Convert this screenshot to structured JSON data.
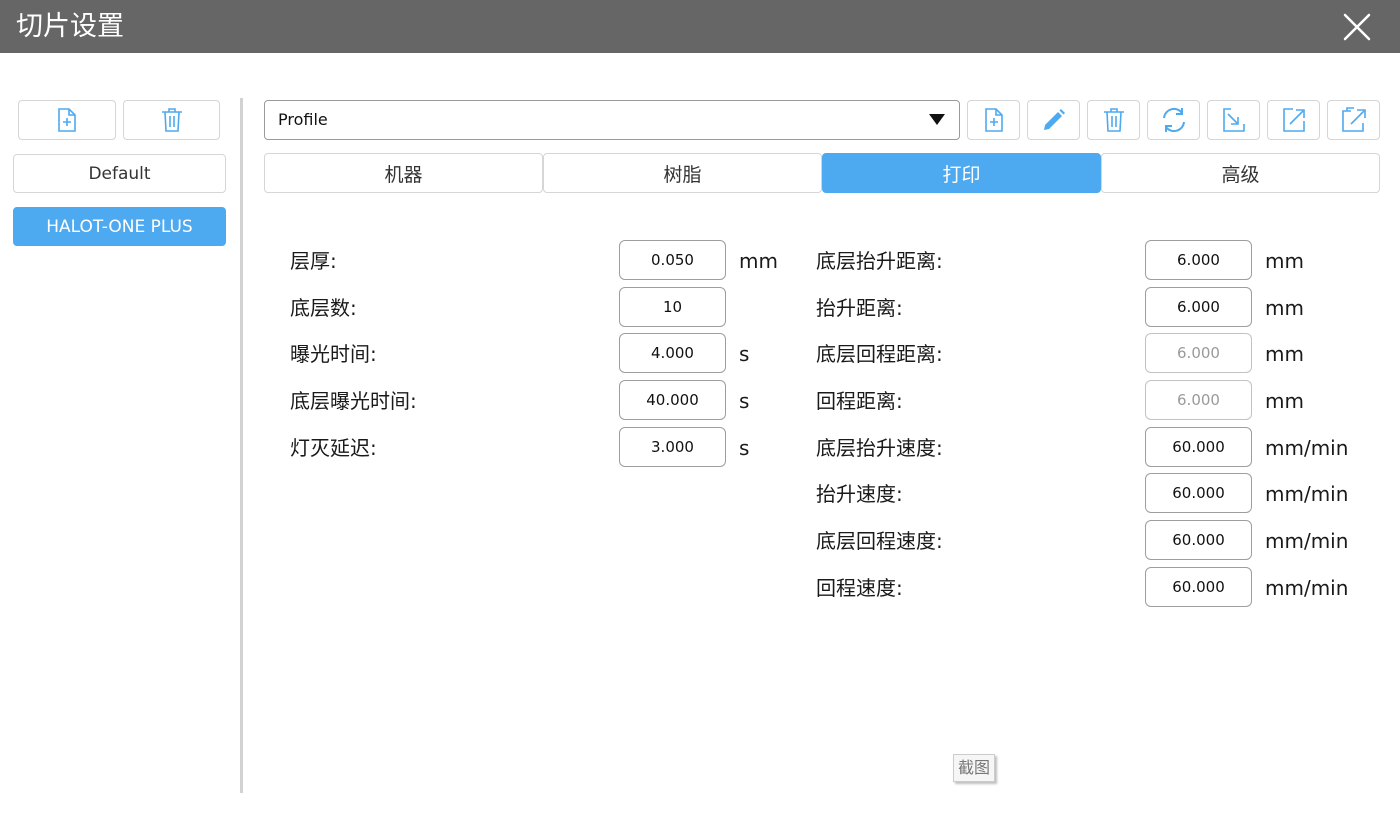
{
  "window": {
    "title": "切片设置"
  },
  "sidebar": {
    "profiles": [
      "Default",
      "HALOT-ONE PLUS"
    ],
    "selected": "HALOT-ONE PLUS"
  },
  "toolbar": {
    "profile_select_value": "Profile"
  },
  "tabs": [
    {
      "label": "机器",
      "active": false
    },
    {
      "label": "树脂",
      "active": false
    },
    {
      "label": "打印",
      "active": true
    },
    {
      "label": "高级",
      "active": false
    }
  ],
  "print_settings": {
    "left": [
      {
        "label": "层厚:",
        "value": "0.050",
        "unit": "mm"
      },
      {
        "label": "底层数:",
        "value": "10",
        "unit": ""
      },
      {
        "label": "曝光时间:",
        "value": "4.000",
        "unit": "s"
      },
      {
        "label": "底层曝光时间:",
        "value": "40.000",
        "unit": "s"
      },
      {
        "label": "灯灭延迟:",
        "value": "3.000",
        "unit": "s"
      }
    ],
    "right": [
      {
        "label": "底层抬升距离:",
        "value": "6.000",
        "unit": "mm",
        "disabled": false
      },
      {
        "label": "抬升距离:",
        "value": "6.000",
        "unit": "mm",
        "disabled": false
      },
      {
        "label": "底层回程距离:",
        "value": "6.000",
        "unit": "mm",
        "disabled": true
      },
      {
        "label": "回程距离:",
        "value": "6.000",
        "unit": "mm",
        "disabled": true
      },
      {
        "label": "底层抬升速度:",
        "value": "60.000",
        "unit": "mm/min",
        "disabled": false
      },
      {
        "label": "抬升速度:",
        "value": "60.000",
        "unit": "mm/min",
        "disabled": false
      },
      {
        "label": "底层回程速度:",
        "value": "60.000",
        "unit": "mm/min",
        "disabled": false
      },
      {
        "label": "回程速度:",
        "value": "60.000",
        "unit": "mm/min",
        "disabled": false
      }
    ]
  },
  "overlay": {
    "stamp": "截图"
  },
  "colors": {
    "titlebar": "#666666",
    "accent": "#4eaaf0",
    "icon": "#4eaaf0"
  }
}
